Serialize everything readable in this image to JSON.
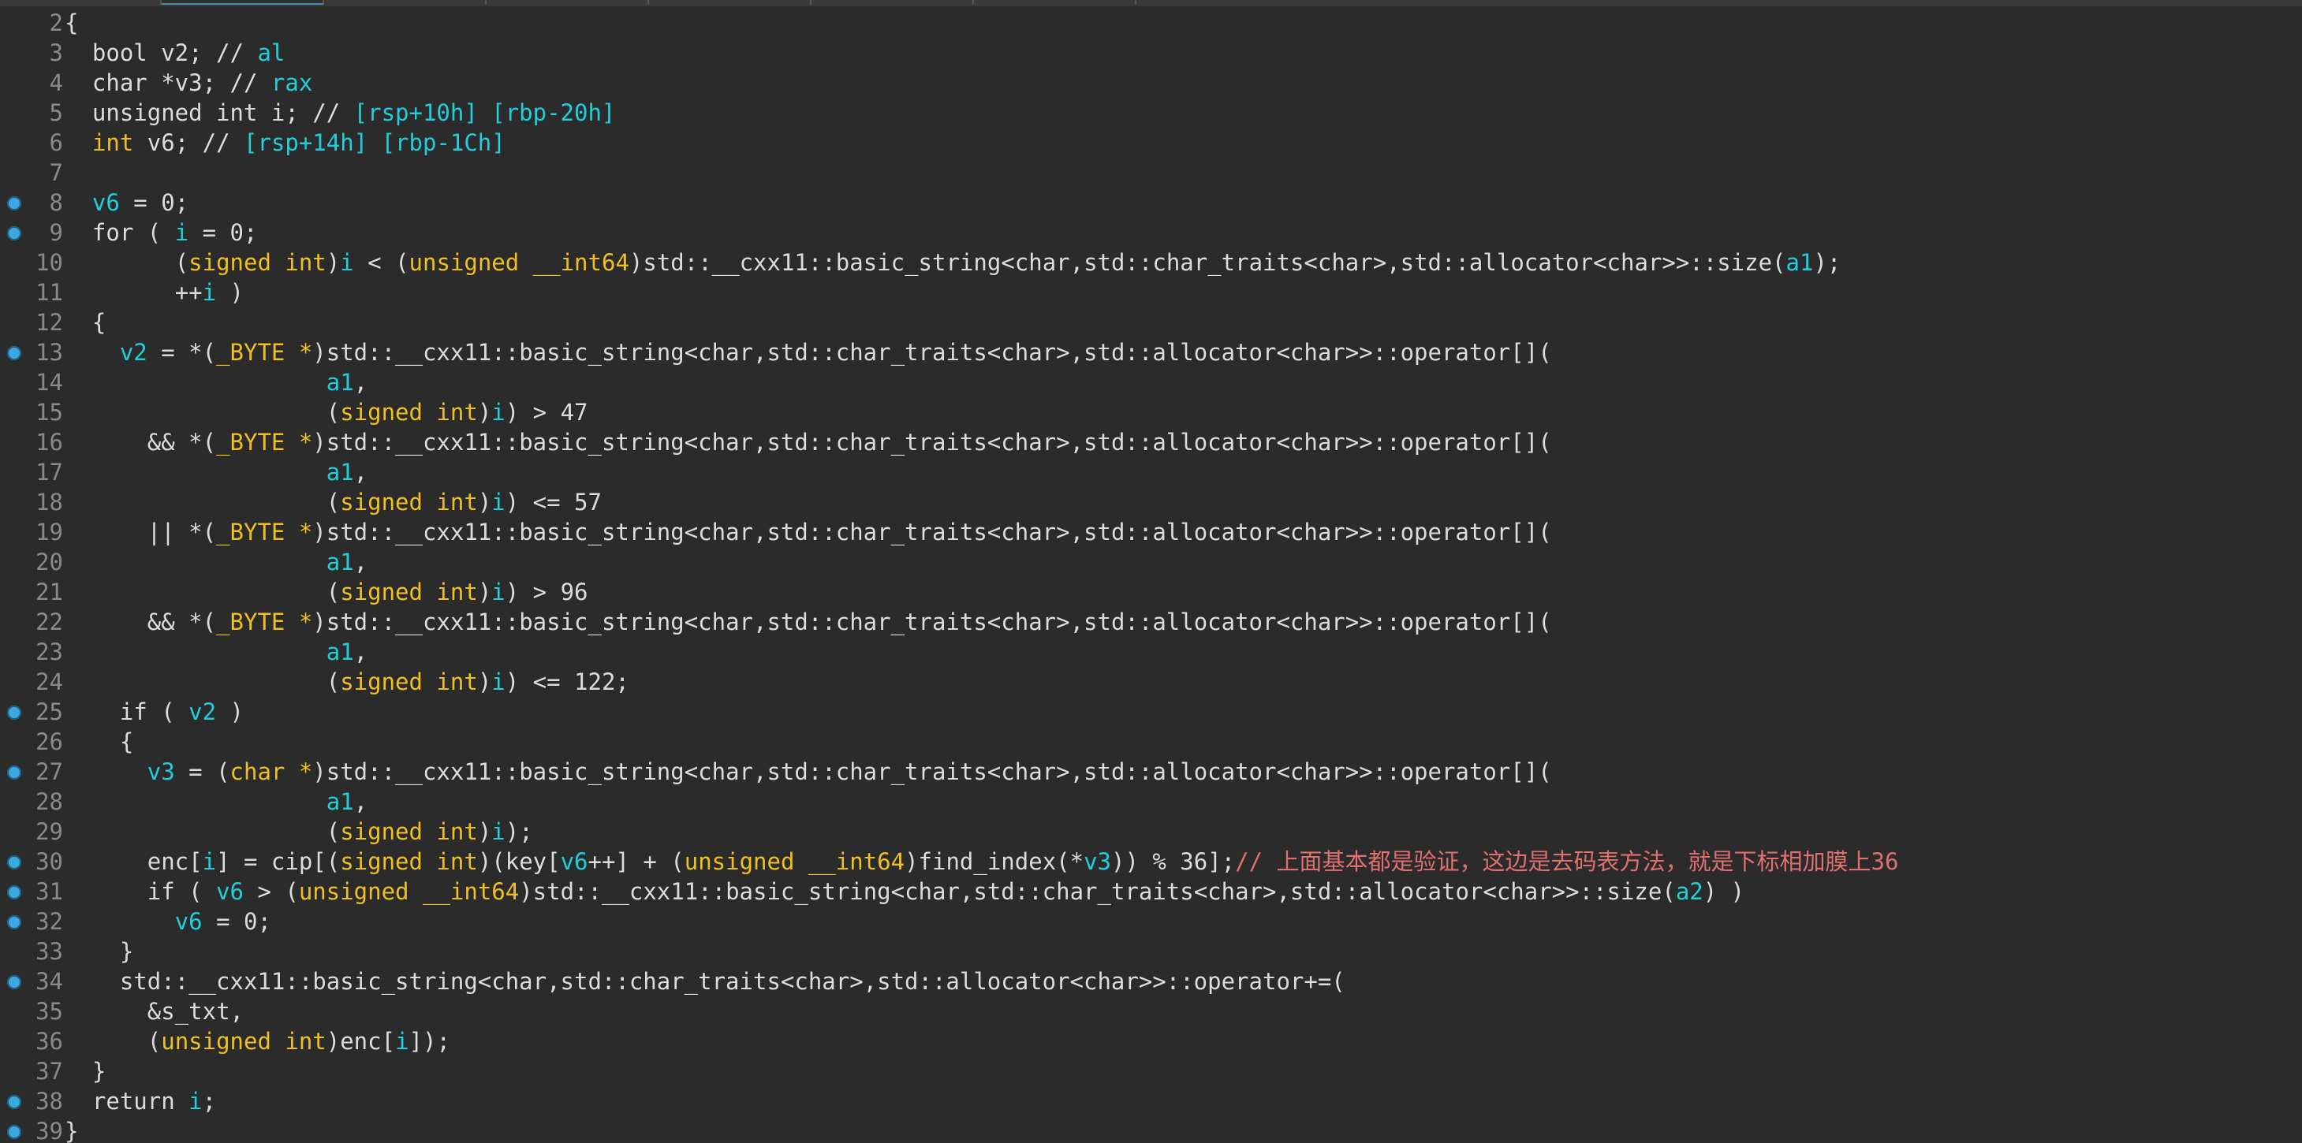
{
  "editor": {
    "lines": [
      {
        "no": "2",
        "bp": false,
        "indent": "",
        "tokens": [
          {
            "t": "{",
            "c": "kw"
          }
        ]
      },
      {
        "no": "3",
        "bp": false,
        "indent": "  ",
        "tokens": [
          {
            "t": "bool v2; // ",
            "c": "kw"
          },
          {
            "t": "al",
            "c": "var"
          }
        ]
      },
      {
        "no": "4",
        "bp": false,
        "indent": "  ",
        "tokens": [
          {
            "t": "char *v3; // ",
            "c": "kw"
          },
          {
            "t": "rax",
            "c": "var"
          }
        ]
      },
      {
        "no": "5",
        "bp": false,
        "indent": "  ",
        "tokens": [
          {
            "t": "unsigned int i; // ",
            "c": "kw"
          },
          {
            "t": "[rsp+10h] [rbp-20h]",
            "c": "var"
          }
        ]
      },
      {
        "no": "6",
        "bp": false,
        "indent": "  ",
        "tokens": [
          {
            "t": "int",
            "c": "ty"
          },
          {
            "t": " v6; // ",
            "c": "kw"
          },
          {
            "t": "[rsp+14h] [rbp-1Ch]",
            "c": "var"
          }
        ]
      },
      {
        "no": "7",
        "bp": false,
        "indent": "",
        "tokens": []
      },
      {
        "no": "8",
        "bp": true,
        "indent": "  ",
        "tokens": [
          {
            "t": "v6",
            "c": "var"
          },
          {
            "t": " = 0;",
            "c": "kw"
          }
        ]
      },
      {
        "no": "9",
        "bp": true,
        "indent": "  ",
        "tokens": [
          {
            "t": "for ( ",
            "c": "kw"
          },
          {
            "t": "i",
            "c": "var"
          },
          {
            "t": " = 0;",
            "c": "kw"
          }
        ]
      },
      {
        "no": "10",
        "bp": false,
        "indent": "        ",
        "tokens": [
          {
            "t": "(",
            "c": "kw"
          },
          {
            "t": "signed int",
            "c": "ty"
          },
          {
            "t": ")",
            "c": "kw"
          },
          {
            "t": "i",
            "c": "var"
          },
          {
            "t": " < (",
            "c": "kw"
          },
          {
            "t": "unsigned __int64",
            "c": "ty"
          },
          {
            "t": ")std::__cxx11::basic_string<char,std::char_traits<char>,std::allocator<char>>::size(",
            "c": "kw"
          },
          {
            "t": "a1",
            "c": "var"
          },
          {
            "t": ");",
            "c": "kw"
          }
        ]
      },
      {
        "no": "11",
        "bp": false,
        "indent": "        ",
        "tokens": [
          {
            "t": "++",
            "c": "kw"
          },
          {
            "t": "i",
            "c": "var"
          },
          {
            "t": " )",
            "c": "kw"
          }
        ]
      },
      {
        "no": "12",
        "bp": false,
        "indent": "  ",
        "tokens": [
          {
            "t": "{",
            "c": "kw"
          }
        ]
      },
      {
        "no": "13",
        "bp": true,
        "indent": "    ",
        "tokens": [
          {
            "t": "v2",
            "c": "var"
          },
          {
            "t": " = *(",
            "c": "kw"
          },
          {
            "t": "_BYTE *",
            "c": "ty"
          },
          {
            "t": ")std::__cxx11::basic_string<char,std::char_traits<char>,std::allocator<char>>::operator[](",
            "c": "kw"
          }
        ]
      },
      {
        "no": "14",
        "bp": false,
        "indent": "                   ",
        "tokens": [
          {
            "t": "a1",
            "c": "var"
          },
          {
            "t": ",",
            "c": "kw"
          }
        ]
      },
      {
        "no": "15",
        "bp": false,
        "indent": "                   ",
        "tokens": [
          {
            "t": "(",
            "c": "kw"
          },
          {
            "t": "signed int",
            "c": "ty"
          },
          {
            "t": ")",
            "c": "kw"
          },
          {
            "t": "i",
            "c": "var"
          },
          {
            "t": ") > 47",
            "c": "kw"
          }
        ]
      },
      {
        "no": "16",
        "bp": false,
        "indent": "      ",
        "tokens": [
          {
            "t": "&& *(",
            "c": "kw"
          },
          {
            "t": "_BYTE *",
            "c": "ty"
          },
          {
            "t": ")std::__cxx11::basic_string<char,std::char_traits<char>,std::allocator<char>>::operator[](",
            "c": "kw"
          }
        ]
      },
      {
        "no": "17",
        "bp": false,
        "indent": "                   ",
        "tokens": [
          {
            "t": "a1",
            "c": "var"
          },
          {
            "t": ",",
            "c": "kw"
          }
        ]
      },
      {
        "no": "18",
        "bp": false,
        "indent": "                   ",
        "tokens": [
          {
            "t": "(",
            "c": "kw"
          },
          {
            "t": "signed int",
            "c": "ty"
          },
          {
            "t": ")",
            "c": "kw"
          },
          {
            "t": "i",
            "c": "var"
          },
          {
            "t": ") <= 57",
            "c": "kw"
          }
        ]
      },
      {
        "no": "19",
        "bp": false,
        "indent": "      ",
        "tokens": [
          {
            "t": "|| *(",
            "c": "kw"
          },
          {
            "t": "_BYTE *",
            "c": "ty"
          },
          {
            "t": ")std::__cxx11::basic_string<char,std::char_traits<char>,std::allocator<char>>::operator[](",
            "c": "kw"
          }
        ]
      },
      {
        "no": "20",
        "bp": false,
        "indent": "                   ",
        "tokens": [
          {
            "t": "a1",
            "c": "var"
          },
          {
            "t": ",",
            "c": "kw"
          }
        ]
      },
      {
        "no": "21",
        "bp": false,
        "indent": "                   ",
        "tokens": [
          {
            "t": "(",
            "c": "kw"
          },
          {
            "t": "signed int",
            "c": "ty"
          },
          {
            "t": ")",
            "c": "kw"
          },
          {
            "t": "i",
            "c": "var"
          },
          {
            "t": ") > 96",
            "c": "kw"
          }
        ]
      },
      {
        "no": "22",
        "bp": false,
        "indent": "      ",
        "tokens": [
          {
            "t": "&& *(",
            "c": "kw"
          },
          {
            "t": "_BYTE *",
            "c": "ty"
          },
          {
            "t": ")std::__cxx11::basic_string<char,std::char_traits<char>,std::allocator<char>>::operator[](",
            "c": "kw"
          }
        ]
      },
      {
        "no": "23",
        "bp": false,
        "indent": "                   ",
        "tokens": [
          {
            "t": "a1",
            "c": "var"
          },
          {
            "t": ",",
            "c": "kw"
          }
        ]
      },
      {
        "no": "24",
        "bp": false,
        "indent": "                   ",
        "tokens": [
          {
            "t": "(",
            "c": "kw"
          },
          {
            "t": "signed int",
            "c": "ty"
          },
          {
            "t": ")",
            "c": "kw"
          },
          {
            "t": "i",
            "c": "var"
          },
          {
            "t": ") <= 122;",
            "c": "kw"
          }
        ]
      },
      {
        "no": "25",
        "bp": true,
        "indent": "    ",
        "tokens": [
          {
            "t": "if ( ",
            "c": "kw"
          },
          {
            "t": "v2",
            "c": "var"
          },
          {
            "t": " )",
            "c": "kw"
          }
        ]
      },
      {
        "no": "26",
        "bp": false,
        "indent": "    ",
        "tokens": [
          {
            "t": "{",
            "c": "kw"
          }
        ]
      },
      {
        "no": "27",
        "bp": true,
        "indent": "      ",
        "tokens": [
          {
            "t": "v3",
            "c": "var"
          },
          {
            "t": " = (",
            "c": "kw"
          },
          {
            "t": "char *",
            "c": "ty"
          },
          {
            "t": ")std::__cxx11::basic_string<char,std::char_traits<char>,std::allocator<char>>::operator[](",
            "c": "kw"
          }
        ]
      },
      {
        "no": "28",
        "bp": false,
        "indent": "                   ",
        "tokens": [
          {
            "t": "a1",
            "c": "var"
          },
          {
            "t": ",",
            "c": "kw"
          }
        ]
      },
      {
        "no": "29",
        "bp": false,
        "indent": "                   ",
        "tokens": [
          {
            "t": "(",
            "c": "kw"
          },
          {
            "t": "signed int",
            "c": "ty"
          },
          {
            "t": ")",
            "c": "kw"
          },
          {
            "t": "i",
            "c": "var"
          },
          {
            "t": ");",
            "c": "kw"
          }
        ]
      },
      {
        "no": "30",
        "bp": true,
        "indent": "      ",
        "tokens": [
          {
            "t": "enc[",
            "c": "kw"
          },
          {
            "t": "i",
            "c": "var"
          },
          {
            "t": "] = cip[(",
            "c": "kw"
          },
          {
            "t": "signed int",
            "c": "ty"
          },
          {
            "t": ")(key[",
            "c": "kw"
          },
          {
            "t": "v6",
            "c": "var"
          },
          {
            "t": "++] + (",
            "c": "kw"
          },
          {
            "t": "unsigned __int64",
            "c": "ty"
          },
          {
            "t": ")find_index(*",
            "c": "kw"
          },
          {
            "t": "v3",
            "c": "var"
          },
          {
            "t": ")) % 36];",
            "c": "kw"
          },
          {
            "t": "// 上面基本都是验证，这边是去码表方法，就是下标相加膜上36",
            "c": "cmt"
          }
        ]
      },
      {
        "no": "31",
        "bp": true,
        "indent": "      ",
        "tokens": [
          {
            "t": "if ( ",
            "c": "kw"
          },
          {
            "t": "v6",
            "c": "var"
          },
          {
            "t": " > (",
            "c": "kw"
          },
          {
            "t": "unsigned __int64",
            "c": "ty"
          },
          {
            "t": ")std::__cxx11::basic_string<char,std::char_traits<char>,std::allocator<char>>::size(",
            "c": "kw"
          },
          {
            "t": "a2",
            "c": "var"
          },
          {
            "t": ") )",
            "c": "kw"
          }
        ]
      },
      {
        "no": "32",
        "bp": true,
        "indent": "        ",
        "tokens": [
          {
            "t": "v6",
            "c": "var"
          },
          {
            "t": " = 0;",
            "c": "kw"
          }
        ]
      },
      {
        "no": "33",
        "bp": false,
        "indent": "    ",
        "tokens": [
          {
            "t": "}",
            "c": "kw"
          }
        ]
      },
      {
        "no": "34",
        "bp": true,
        "indent": "    ",
        "tokens": [
          {
            "t": "std::__cxx11::basic_string<char,std::char_traits<char>,std::allocator<char>>::operator+=(",
            "c": "kw"
          }
        ]
      },
      {
        "no": "35",
        "bp": false,
        "indent": "      ",
        "tokens": [
          {
            "t": "&s_txt,",
            "c": "kw"
          }
        ]
      },
      {
        "no": "36",
        "bp": false,
        "indent": "      ",
        "tokens": [
          {
            "t": "(",
            "c": "kw"
          },
          {
            "t": "unsigned int",
            "c": "ty"
          },
          {
            "t": ")enc[",
            "c": "kw"
          },
          {
            "t": "i",
            "c": "var"
          },
          {
            "t": "]);",
            "c": "kw"
          }
        ]
      },
      {
        "no": "37",
        "bp": false,
        "indent": "  ",
        "tokens": [
          {
            "t": "}",
            "c": "kw"
          }
        ]
      },
      {
        "no": "38",
        "bp": true,
        "indent": "  ",
        "tokens": [
          {
            "t": "return ",
            "c": "kw"
          },
          {
            "t": "i",
            "c": "var"
          },
          {
            "t": ";",
            "c": "kw"
          }
        ]
      },
      {
        "no": "39",
        "bp": true,
        "indent": "",
        "tokens": [
          {
            "t": "}",
            "c": "kw"
          }
        ]
      }
    ]
  },
  "colors": {
    "background": "#2b2b2b",
    "default_text": "#dcdcdc",
    "type_keyword": "#f0c020",
    "variable": "#1fd0dc",
    "comment": "#e07070",
    "line_number": "#8a8a8a",
    "breakpoint": "#3ca8e0"
  }
}
